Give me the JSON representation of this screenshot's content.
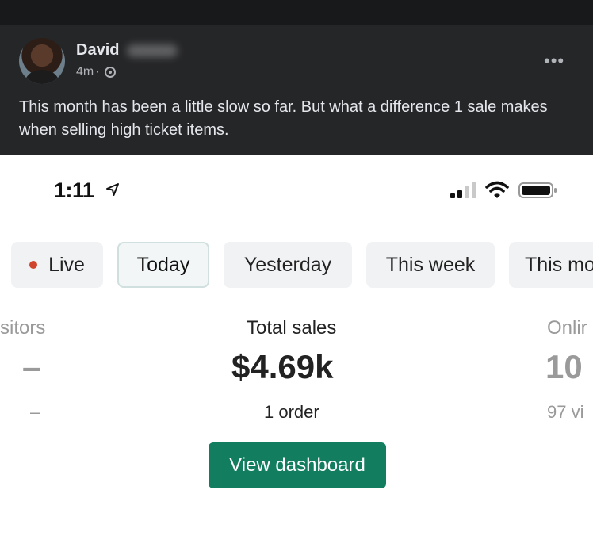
{
  "post": {
    "author_first": "David",
    "time": "4m",
    "separator": "·",
    "audience_icon": "globe-icon",
    "more_icon": "more-options-icon",
    "more_glyph": "•••",
    "text": "This month has been a little slow so far. But what a difference 1 sale makes when selling high ticket items."
  },
  "phone": {
    "status_bar": {
      "time": "1:11",
      "icons": [
        "location-arrow-icon",
        "signal-icon",
        "wifi-icon",
        "battery-icon"
      ]
    },
    "filters": [
      {
        "label": "Live",
        "has_dot": true,
        "active": false
      },
      {
        "label": "Today",
        "active": true
      },
      {
        "label": "Yesterday",
        "active": false
      },
      {
        "label": "This week",
        "active": false
      },
      {
        "label": "This mo",
        "active": false
      }
    ],
    "metrics": {
      "left": {
        "label": "sitors",
        "value": "–",
        "sub": "–"
      },
      "center": {
        "label": "Total sales",
        "value": "$4.69k",
        "sub": "1 order"
      },
      "right": {
        "label": "Onlir",
        "value": "10",
        "sub": "97 vi"
      }
    },
    "view_dashboard_label": "View dashboard"
  },
  "colors": {
    "post_background": "#252628",
    "accent_green": "#127e5f",
    "live_dot": "#d0442d"
  }
}
